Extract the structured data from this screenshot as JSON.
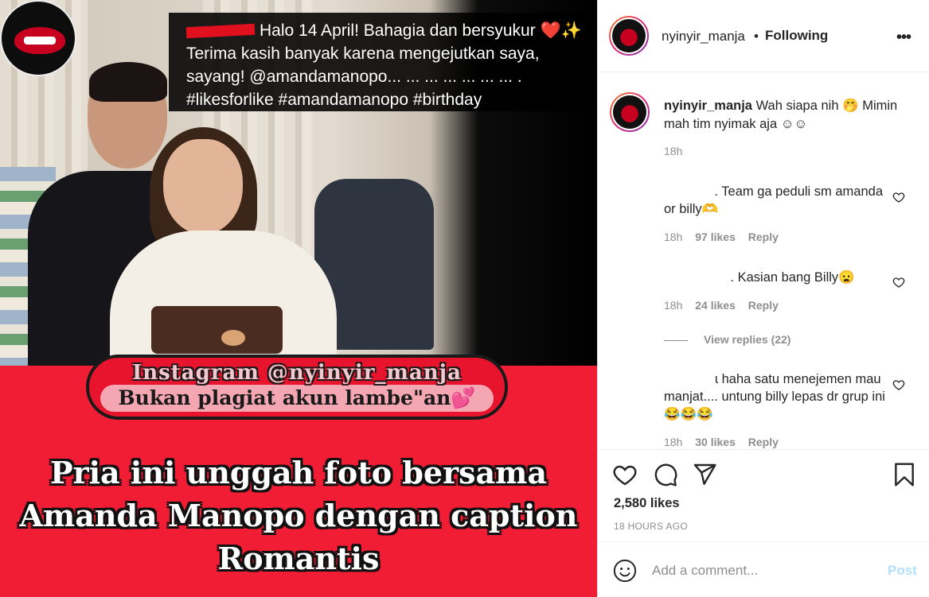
{
  "image": {
    "logo_text": "@nyinyir_manja",
    "caption_lines": [
      "Halo 14 April! Bahagia dan bersyukur ❤️✨",
      "Terima kasih banyak karena mengejutkan saya,",
      "sayang! @amandamanopo... ... ... ... ... ... ... .",
      "#likesforlike #amandamanopo #birthday"
    ],
    "watermark_line1": "Instagram @nyinyir_manja",
    "watermark_line2": "Bukan plagiat akun lambe\"an💕",
    "headline_lines": [
      "Pria ini unggah foto bersama",
      "Amanda Manopo dengan caption",
      "Romantis"
    ]
  },
  "header": {
    "username": "nyinyir_manja",
    "separator": "•",
    "follow_status": "Following",
    "more_icon": "more-options-icon"
  },
  "caption": {
    "username": "nyinyir_manja",
    "text": "Wah siapa nih 🤭 Mimin mah tim nyimak aja ☺︎☺︎",
    "time": "18h"
  },
  "comments": [
    {
      "user_fragment": ".",
      "text": "Team ga peduli sm amanda or billy🫶",
      "time": "18h",
      "likes": "97 likes",
      "reply": "Reply"
    },
    {
      "user_fragment": ".",
      "text": "Kasian bang Billy😦",
      "time": "18h",
      "likes": "24 likes",
      "reply": "Reply"
    },
    {
      "user_fragment": "ɩ",
      "text": "haha satu menejemen mau manjat.... untung billy lepas dr grup ini 😂😂😂",
      "time": "18h",
      "likes": "30 likes",
      "reply": "Reply"
    }
  ],
  "view_replies": "View replies (22)",
  "actions": {
    "icons": [
      "heart-icon",
      "comment-icon",
      "share-icon",
      "bookmark-icon"
    ],
    "like_count": "2,580 likes",
    "post_time": "18 HOURS AGO"
  },
  "add_comment": {
    "placeholder": "Add a comment...",
    "post_label": "Post",
    "emoji_icon": "emoji-icon"
  }
}
